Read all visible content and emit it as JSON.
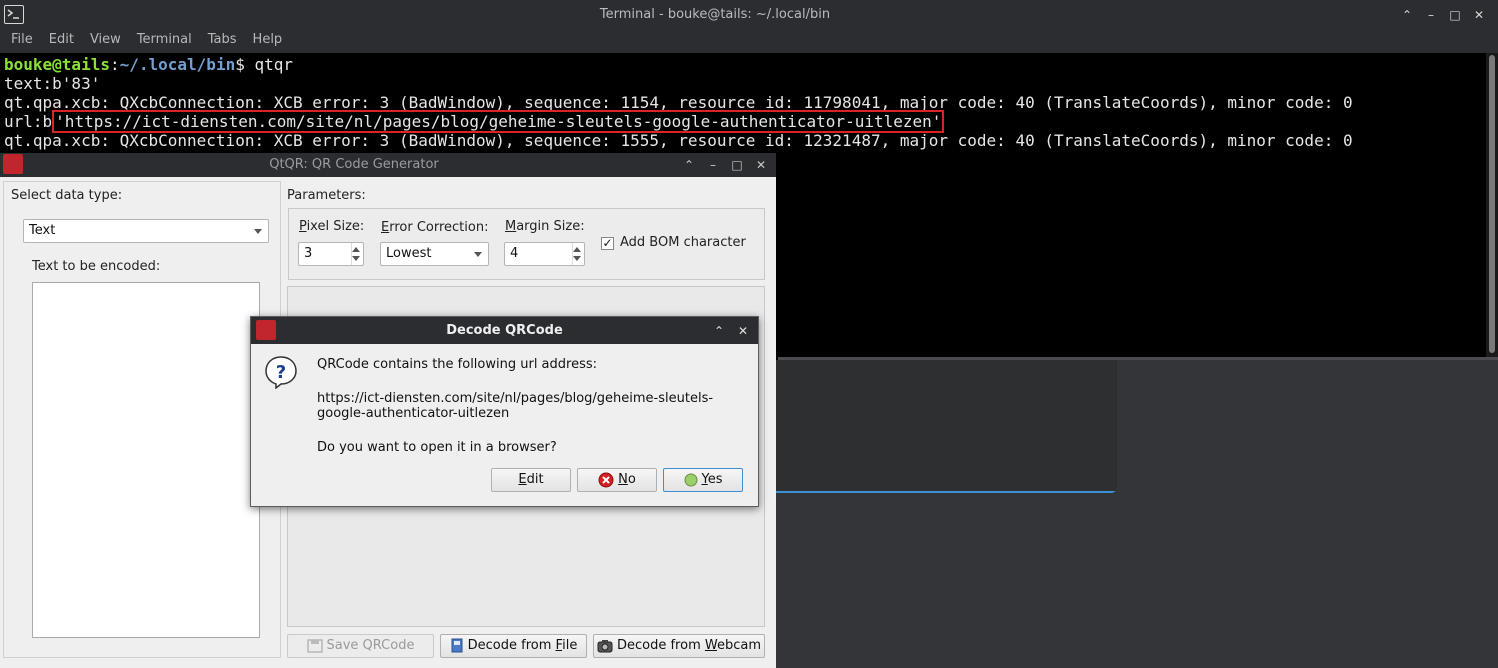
{
  "terminal": {
    "title": "Terminal - bouke@tails: ~/.local/bin",
    "menu": [
      "File",
      "Edit",
      "View",
      "Terminal",
      "Tabs",
      "Help"
    ],
    "prompt_user": "bouke@tails",
    "prompt_sep": ":",
    "prompt_path": "~/.local/bin",
    "prompt_end": "$ ",
    "command": "qtqr",
    "line1": "text:b'83'",
    "line2": "qt.qpa.xcb: QXcbConnection: XCB error: 3 (BadWindow), sequence: 1154, resource id: 11798041, major code: 40 (TranslateCoords), minor code: 0",
    "line3_prefix": "url:b",
    "line3_url": "'https://ict-diensten.com/site/nl/pages/blog/geheime-sleutels-google-authenticator-uitlezen'",
    "line4": "qt.qpa.xcb: QXcbConnection: XCB error: 3 (BadWindow), sequence: 1555, resource id: 12321487, major code: 40 (TranslateCoords), minor code: 0"
  },
  "qtqr": {
    "title": "QtQR: QR Code Generator",
    "select_data_type_label": "Select data type:",
    "data_type_value": "Text",
    "text_to_encode_label": "Text to be encoded:",
    "parameters_label": "Parameters:",
    "pixel_size_label_first": "P",
    "pixel_size_label_rest": "ixel Size:",
    "pixel_size_value": "3",
    "error_correction_label_first": "E",
    "error_correction_label_rest": "rror Correction:",
    "error_correction_value": "Lowest",
    "margin_size_label_first": "M",
    "margin_size_label_rest": "argin Size:",
    "margin_size_value": "4",
    "add_bom_label": "Add BOM character",
    "add_bom_checked": "✓",
    "save_button": "Save QRCode",
    "decode_file_prefix": "Decode from ",
    "decode_file_key": "F",
    "decode_file_rest": "ile",
    "decode_webcam_prefix": "Decode from ",
    "decode_webcam_key": "W",
    "decode_webcam_rest": "ebcam"
  },
  "dialog": {
    "title": "Decode QRCode",
    "message1": "QRCode contains the following url address:",
    "url_line1": "https://ict-diensten.com/site/nl/pages/blog/geheime-sleutels-",
    "url_line2": "google-authenticator-uitlezen",
    "question": "Do you want to open it in a browser?",
    "edit_key": "E",
    "edit_rest": "dit",
    "no_key": "N",
    "no_rest": "o",
    "yes_key": "Y",
    "yes_rest": "es"
  },
  "colors": {
    "terminal_bg": "#000000",
    "prompt_user": "#8ae234",
    "prompt_path": "#729fcf",
    "highlight_box": "#dd2222",
    "titlebar": "#2b2d30",
    "qt_bg": "#efefef",
    "focus_border": "#3d8fd6"
  }
}
